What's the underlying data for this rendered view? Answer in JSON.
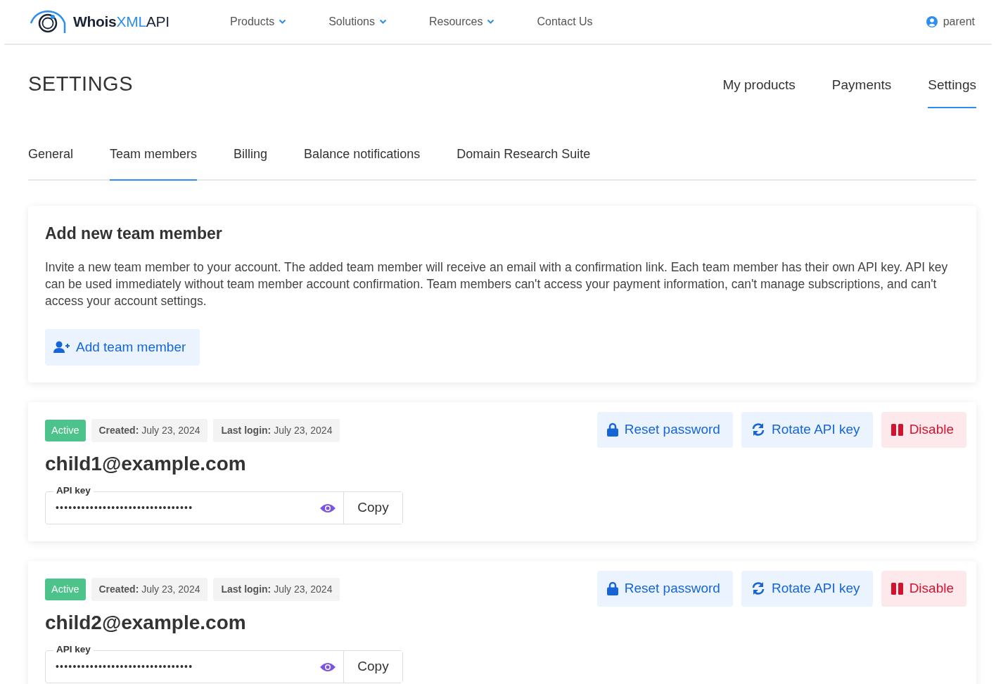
{
  "header": {
    "logo": [
      {
        "kind": "bold",
        "text": "Whois"
      },
      {
        "kind": "accent",
        "text": "XML"
      },
      {
        "kind": "plain",
        "text": "API"
      }
    ],
    "nav": [
      {
        "label": "Products",
        "dropdown": true
      },
      {
        "label": "Solutions",
        "dropdown": true
      },
      {
        "label": "Resources",
        "dropdown": true
      },
      {
        "label": "Contact Us",
        "dropdown": false
      }
    ],
    "user": "parent"
  },
  "page_title": "SETTINGS",
  "page_tabs": [
    {
      "label": "My products",
      "selected": false
    },
    {
      "label": "Payments",
      "selected": false
    },
    {
      "label": "Settings",
      "selected": true
    }
  ],
  "settings_tabs": [
    {
      "label": "General",
      "selected": false
    },
    {
      "label": "Team members",
      "selected": true
    },
    {
      "label": "Billing",
      "selected": false
    },
    {
      "label": "Balance notifications",
      "selected": false
    },
    {
      "label": "Domain Research Suite",
      "selected": false
    }
  ],
  "add_card": {
    "title": "Add new team member",
    "text": "Invite a new team member to your account. The added team member will receive an email with a confirmation link. Each team member has their own API key. API key can be used immediately without team member account confirmation. Team members can't access your payment information, can't manage subscriptions, and can't access your account settings.",
    "button": "Add team member"
  },
  "members": [
    {
      "status": "Active",
      "created_label": "Created:",
      "created": "July 23, 2024",
      "login_label": "Last login:",
      "last_login": "July 23, 2024",
      "email": "child1@example.com",
      "api_key_label": "API key",
      "api_key": "••••••••••••••••••••••••••••••••",
      "copy": "Copy",
      "actions": [
        {
          "kind": "reset",
          "label": "Reset password"
        },
        {
          "kind": "rotate",
          "label": "Rotate API key"
        },
        {
          "kind": "disable",
          "label": "Disable"
        }
      ]
    },
    {
      "status": "Active",
      "created_label": "Created:",
      "created": "July 23, 2024",
      "login_label": "Last login:",
      "last_login": "July 23, 2024",
      "email": "child2@example.com",
      "api_key_label": "API key",
      "api_key": "••••••••••••••••••••••••••••••••",
      "copy": "Copy",
      "actions": [
        {
          "kind": "reset",
          "label": "Reset password"
        },
        {
          "kind": "rotate",
          "label": "Rotate API key"
        },
        {
          "kind": "disable",
          "label": "Disable"
        }
      ]
    }
  ]
}
